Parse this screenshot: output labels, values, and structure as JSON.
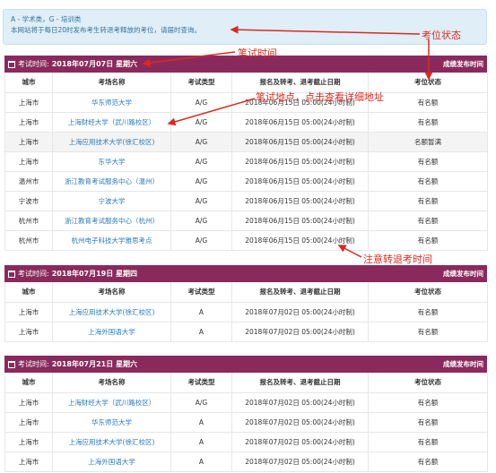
{
  "notice": {
    "line1": "A - 学术类，G - 培训类",
    "line2": "本网站将于每日20时发布考生转退考释放的考位，请届时查询。"
  },
  "columns": [
    "城市",
    "考场名称",
    "考试类型",
    "报名及转考、退考截止日期",
    "考位状态"
  ],
  "sections": [
    {
      "label": "考试时间:",
      "date": "2018年07月07日 星期六",
      "right": "成绩发布时间",
      "rows": [
        [
          "上海市",
          "华东师范大学",
          "A/G",
          "2018年06月15日 05:00(24小时制)",
          "有名额"
        ],
        [
          "上海市",
          "上海财经大学（武川路校区）",
          "A/G",
          "2018年06月15日 05:00(24小时制)",
          "有名额"
        ],
        [
          "上海市",
          "上海应用技术大学(徐汇校区)",
          "A/G",
          "2018年06月15日 05:00(24小时制)",
          "名额暂满"
        ],
        [
          "上海市",
          "东华大学",
          "A/G",
          "2018年06月15日 05:00(24小时制)",
          "有名额"
        ],
        [
          "温州市",
          "浙江教育考试服务中心（温州）",
          "A/G",
          "2018年06月15日 05:00(24小时制)",
          "有名额"
        ],
        [
          "宁波市",
          "宁波大学",
          "A/G",
          "2018年06月15日 05:00(24小时制)",
          "有名额"
        ],
        [
          "杭州市",
          "浙江教育考试服务中心（杭州）",
          "A/G",
          "2018年06月15日 05:00(24小时制)",
          "有名额"
        ],
        [
          "杭州市",
          "杭州电子科技大学雅思考点",
          "A/G",
          "2018年06月15日 05:00(24小时制)",
          "有名额"
        ]
      ]
    },
    {
      "label": "考试时间:",
      "date": "2018年07月19日 星期四",
      "right": "成绩发布时间",
      "rows": [
        [
          "上海市",
          "上海应用技术大学(徐汇校区)",
          "A",
          "2018年07月02日 05:00(24小时制)",
          "有名额"
        ],
        [
          "上海市",
          "上海外国语大学",
          "A",
          "2018年07月02日 05:00(24小时制)",
          "有名额"
        ]
      ]
    },
    {
      "label": "考试时间:",
      "date": "2018年07月21日 星期六",
      "right": "成绩发布时间",
      "rows": [
        [
          "上海市",
          "上海财经大学（武川路校区）",
          "A/G",
          "2018年07月02日 05:00(24小时制)",
          "有名额"
        ],
        [
          "上海市",
          "华东师范大学",
          "A",
          "2018年07月02日 05:00(24小时制)",
          "有名额"
        ],
        [
          "上海市",
          "上海应用技术大学(徐汇校区)",
          "A",
          "2018年07月02日 05:00(24小时制)",
          "有名额"
        ],
        [
          "上海市",
          "上海外国语大学",
          "A",
          "2018年07月02日 05:00(24小时制)",
          "有名额"
        ]
      ]
    }
  ],
  "annotations": {
    "seat_status": "考位状态",
    "exam_time": "笔试时间",
    "exam_location": "笔试地点，点击查看详细地址",
    "withdraw_time": "注意转退考时间"
  },
  "colors": {
    "header_bg": "#8a2a5c",
    "link": "#2a7ab8",
    "annotation": "#d92a20",
    "notice_bg": "#dfeef7"
  }
}
